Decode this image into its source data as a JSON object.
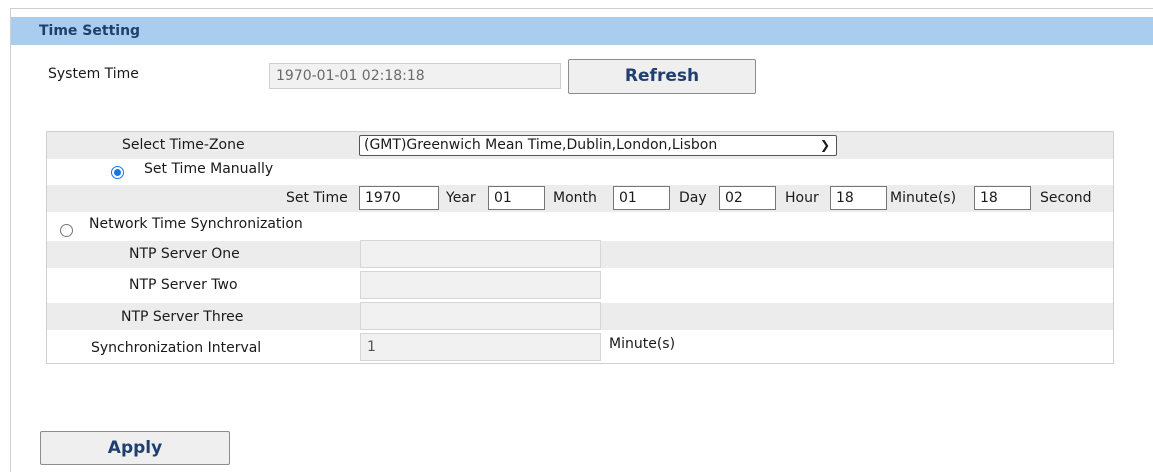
{
  "section": {
    "title": "Time Setting"
  },
  "system_time": {
    "label": "System Time",
    "value": "1970-01-01 02:18:18",
    "refresh_label": "Refresh"
  },
  "timezone": {
    "label": "Select Time-Zone",
    "selected": "(GMT)Greenwich Mean Time,Dublin,London,Lisbon"
  },
  "manual": {
    "radio_label": "Set Time Manually",
    "set_time_label": "Set Time",
    "year": "1970",
    "year_label": "Year",
    "month": "01",
    "month_label": "Month",
    "day": "01",
    "day_label": "Day",
    "hour": "02",
    "hour_label": "Hour",
    "minute": "18",
    "minute_label": "Minute(s)",
    "second": "18",
    "second_label": "Second"
  },
  "ntp": {
    "radio_label": "Network Time Synchronization",
    "server_one_label": "NTP Server One",
    "server_one": "",
    "server_two_label": "NTP Server Two",
    "server_two": "",
    "server_three_label": "NTP Server Three",
    "server_three": "",
    "interval_label": "Synchronization Interval",
    "interval": "1",
    "interval_unit": "Minute(s)"
  },
  "apply_label": "Apply",
  "colors": {
    "title_bar": "#a9cdee",
    "title_text": "#1f3f6e",
    "radio_accent": "#1a73e8"
  }
}
